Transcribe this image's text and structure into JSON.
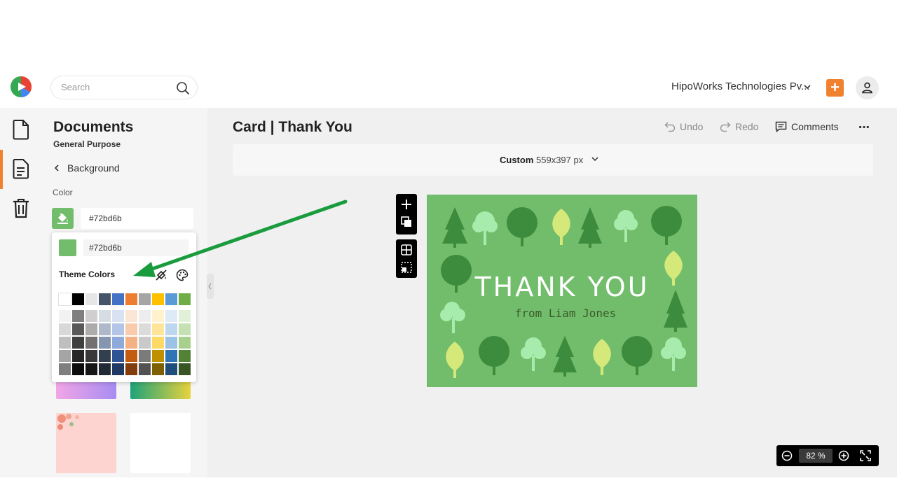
{
  "search": {
    "placeholder": "Search"
  },
  "header": {
    "organization": "HipoWorks Technologies Pv...",
    "add_label": "+"
  },
  "panel": {
    "title": "Documents",
    "subtitle": "General Purpose",
    "back_label": "Background",
    "color_label": "Color",
    "color_value": "#72bd6b"
  },
  "picker": {
    "hex_value": "#72bd6b",
    "theme_label": "Theme Colors",
    "top_row": [
      "#ffffff",
      "#000000",
      "#e7e6e6",
      "#44546a",
      "#4472c4",
      "#ed7d31",
      "#a5a5a5",
      "#ffc000",
      "#5b9bd5",
      "#70ad47"
    ],
    "shade_rows": [
      [
        "#f2f2f2",
        "#7f7f7f",
        "#d0cece",
        "#d6dce4",
        "#d9e2f3",
        "#fbe5d5",
        "#ededed",
        "#fff2cc",
        "#deebf6",
        "#e2efd9"
      ],
      [
        "#d8d8d8",
        "#595959",
        "#aeabab",
        "#adb9ca",
        "#b4c6e7",
        "#f7cbac",
        "#dbdbdb",
        "#fee599",
        "#bdd7ee",
        "#c5e0b3"
      ],
      [
        "#bfbfbf",
        "#3f3f3f",
        "#757070",
        "#8496b0",
        "#8eaadb",
        "#f4b183",
        "#c9c9c9",
        "#ffd965",
        "#9cc3e5",
        "#a8d08d"
      ],
      [
        "#a5a5a5",
        "#262626",
        "#3a3838",
        "#323f4f",
        "#2f5496",
        "#c55a11",
        "#7b7b7b",
        "#bf9000",
        "#2e75b5",
        "#538135"
      ],
      [
        "#7f7f7f",
        "#0c0c0c",
        "#171616",
        "#222a35",
        "#1f3864",
        "#833c0b",
        "#525252",
        "#7f6000",
        "#1e4e79",
        "#375623"
      ]
    ]
  },
  "document": {
    "title": "Card | Thank You",
    "undo_label": "Undo",
    "redo_label": "Redo",
    "comments_label": "Comments",
    "more_label": "⋯",
    "size_preset": "Custom",
    "size_value": "559x397 px",
    "zoom_value": "82",
    "zoom_unit": "%"
  },
  "card": {
    "background": "#72bd6b",
    "title": "THANK YOU",
    "subtitle": "from Liam Jones"
  },
  "colors": {
    "accent": "#f0812f",
    "arrow": "#1a9c3e"
  }
}
